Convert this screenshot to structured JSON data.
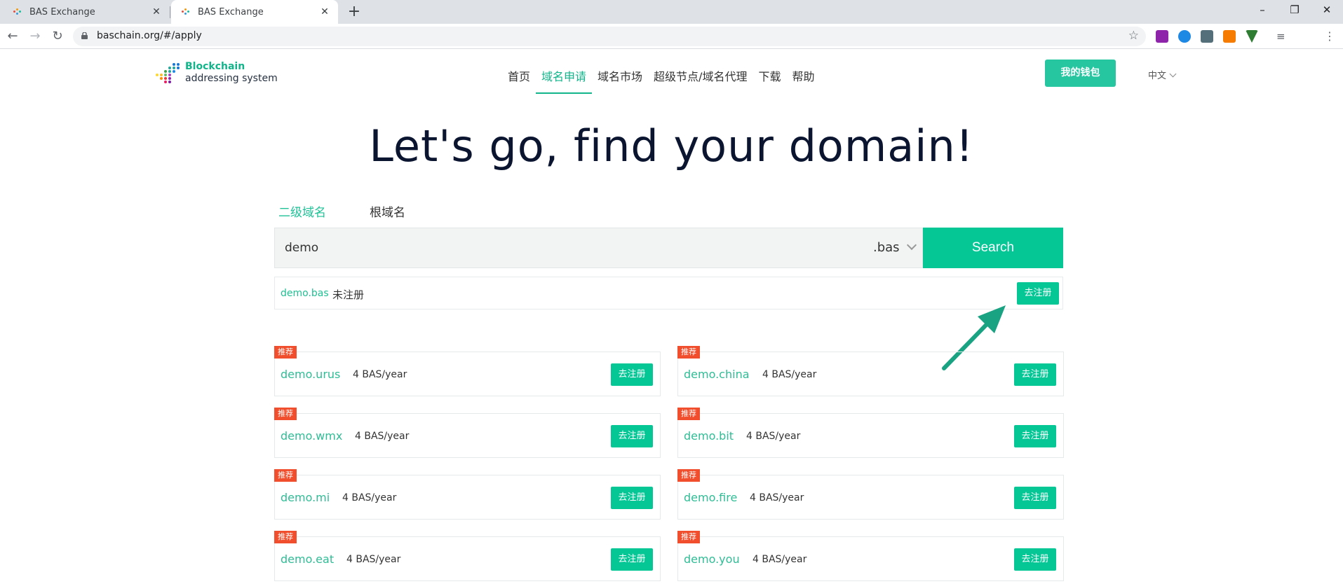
{
  "browser": {
    "tabs": [
      {
        "title": "BAS Exchange",
        "active": false
      },
      {
        "title": "BAS Exchange",
        "active": true
      }
    ],
    "url": "baschain.org/#/apply"
  },
  "site": {
    "logo": {
      "line1": "Blockchain",
      "line2": "addressing system"
    },
    "nav": [
      "首页",
      "域名申请",
      "域名市场",
      "超级节点/域名代理",
      "下载",
      "帮助"
    ],
    "nav_active_index": 1,
    "wallet_button": "我的钱包",
    "language": "中文"
  },
  "hero": {
    "title": "Let's go, find your domain!"
  },
  "search": {
    "tabs": [
      "二级域名",
      "根域名"
    ],
    "query": "demo",
    "suffix": ".bas",
    "button": "Search"
  },
  "result": {
    "domain": "demo.bas",
    "status": "未注册",
    "button": "去注册"
  },
  "suggestions": {
    "badge": "推荐",
    "button": "去注册",
    "items": [
      {
        "domain": "demo.urus",
        "price": "4 BAS/year"
      },
      {
        "domain": "demo.china",
        "price": "4 BAS/year"
      },
      {
        "domain": "demo.wmx",
        "price": "4 BAS/year"
      },
      {
        "domain": "demo.bit",
        "price": "4 BAS/year"
      },
      {
        "domain": "demo.mi",
        "price": "4 BAS/year"
      },
      {
        "domain": "demo.fire",
        "price": "4 BAS/year"
      },
      {
        "domain": "demo.eat",
        "price": "4 BAS/year"
      },
      {
        "domain": "demo.you",
        "price": "4 BAS/year"
      }
    ]
  },
  "colors": {
    "brand": "#05c796",
    "badge": "#f04e2c",
    "heading": "#0b1530",
    "tab_dark": "#0b1530"
  }
}
